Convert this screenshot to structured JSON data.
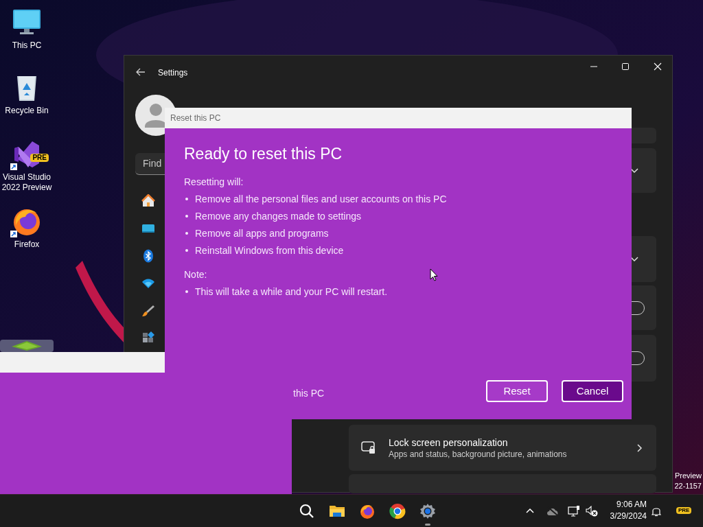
{
  "desktop_icons": [
    {
      "kind": "monitor",
      "label": "This PC"
    },
    {
      "kind": "bin",
      "label": "Recycle Bin"
    },
    {
      "kind": "vs",
      "label": "Visual Studio 2022 Preview",
      "badge": "PRE"
    },
    {
      "kind": "firefox",
      "label": "Firefox"
    }
  ],
  "build_text": [
    "Preview",
    "22-1157"
  ],
  "settings_window": {
    "title": "Settings",
    "search": {
      "placeholder": "Find"
    },
    "cards": [
      {
        "kind": "blank"
      },
      {
        "kind": "expander"
      },
      {
        "kind": "expander"
      },
      {
        "kind": "toggle",
        "on": false
      },
      {
        "kind": "toggle",
        "on": false
      },
      {
        "kind": "link",
        "title": "Lock screen personalization",
        "subtitle": "Apps and status, background picture, animations"
      },
      {
        "kind": "blank"
      }
    ]
  },
  "dialog": {
    "title": "Reset this PC",
    "heading": "Ready to reset this PC",
    "sections": [
      {
        "label": "Resetting will:",
        "bullets": [
          "Remove all the personal files and user accounts on this PC",
          "Remove any changes made to settings",
          "Remove all apps and programs",
          "Reinstall Windows from this device"
        ]
      },
      {
        "label": "Note:",
        "bullets": [
          "This will take a while and your PC will restart."
        ]
      }
    ],
    "fragment": "this PC",
    "buttons": [
      {
        "label": "Reset",
        "default": false
      },
      {
        "label": "Cancel",
        "default": true
      }
    ]
  },
  "taskbar": {
    "apps": [
      {
        "kind": "search",
        "active": false
      },
      {
        "kind": "folder",
        "active": false
      },
      {
        "kind": "firefox",
        "active": false
      },
      {
        "kind": "chrome",
        "active": false
      },
      {
        "kind": "settings",
        "active": true
      }
    ],
    "time": "9:06 AM",
    "date": "3/29/2024",
    "badge": "PRE"
  }
}
